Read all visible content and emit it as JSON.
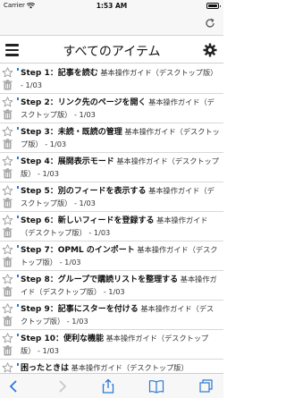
{
  "status_bar": {
    "carrier": "Carrier",
    "time": "1:53 AM"
  },
  "header": {
    "title": "すべてのアイテム"
  },
  "items": [
    {
      "title": "Step 1：記事を読む",
      "feed": "基本操作ガイド（デスクトップ版）",
      "date": "- 1/03",
      "unread": true
    },
    {
      "title": "Step 2：リンク先のページを開く",
      "feed": "基本操作ガイド（デスクトップ版）",
      "date": "- 1/03",
      "unread": true
    },
    {
      "title": "Step 3：未読・既読の管理",
      "feed": "基本操作ガイド（デスクトップ版）",
      "date": "- 1/03",
      "unread": true
    },
    {
      "title": "Step 4：展開表示モード",
      "feed": "基本操作ガイド（デスクトップ版）",
      "date": "- 1/03",
      "unread": true
    },
    {
      "title": "Step 5：別のフィードを表示する",
      "feed": "基本操作ガイド（デスクトップ版）",
      "date": "- 1/03",
      "unread": true
    },
    {
      "title": "Step 6：新しいフィードを登録する",
      "feed": "基本操作ガイド（デスクトップ版）",
      "date": "- 1/03",
      "unread": true
    },
    {
      "title": "Step 7：OPML のインポート",
      "feed": "基本操作ガイド（デスクトップ版）",
      "date": "- 1/03",
      "unread": true
    },
    {
      "title": "Step 8：グループで購読リストを整理する",
      "feed": "基本操作ガイド（デスクトップ版）",
      "date": "- 1/03",
      "unread": true
    },
    {
      "title": "Step 9：記事にスターを付ける",
      "feed": "基本操作ガイド（デスクトップ版）",
      "date": "- 1/03",
      "unread": true
    },
    {
      "title": "Step 10：便利な機能",
      "feed": "基本操作ガイド（デスクトップ版）",
      "date": "- 1/03",
      "unread": true
    },
    {
      "title": "困ったときは",
      "feed": "基本操作ガイド（デスクトップ版）",
      "date": "",
      "unread": true
    }
  ],
  "icons": {
    "star": "star-outline-icon",
    "trash": "trash-icon",
    "menu": "hamburger-menu-icon",
    "settings": "gear-icon"
  },
  "colors": {
    "accent": "#2a78d6",
    "icon_gray": "#9a9a9a"
  }
}
